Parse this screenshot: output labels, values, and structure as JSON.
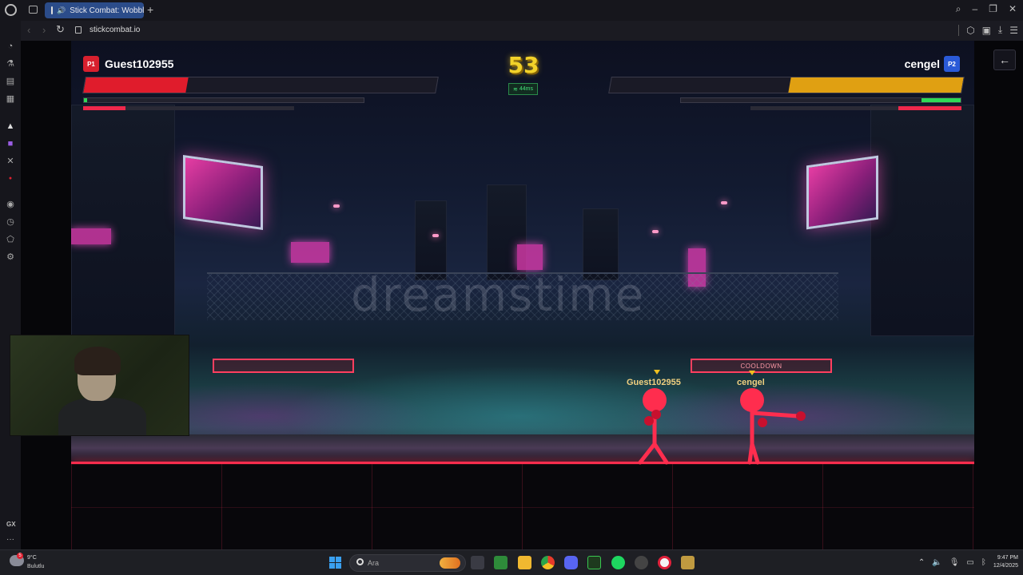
{
  "browser": {
    "tab_title": "Stick Combat: Wobbl",
    "url": "stickcombat.io",
    "new_tab": "+",
    "sidebar_bottom": "GX"
  },
  "game": {
    "timer": "53",
    "ping": "44ms",
    "watermark": "dreamstime",
    "player1": {
      "badge": "P1",
      "name": "Guest102955",
      "health_fraction": 0.29,
      "energy_fraction": 0.01,
      "special_fraction": 0.2,
      "cooldown_text": ""
    },
    "player2": {
      "badge": "P2",
      "name": "cengel",
      "health_fraction": 0.49,
      "energy_fraction": 0.14,
      "special_fraction": 0.3,
      "cooldown_text": "COOLDOWN"
    },
    "colors": {
      "p1": "#e01c2c",
      "p2": "#e0a012",
      "energy": "#2fd856",
      "neon": "#ff2d4e",
      "timer": "#f2d22a"
    }
  },
  "taskbar": {
    "weather_temp": "9°C",
    "weather_desc": "Bulutlu",
    "weather_alert": "5",
    "search_placeholder": "Ara",
    "time": "9:47 PM",
    "date": "12/4/2025"
  }
}
